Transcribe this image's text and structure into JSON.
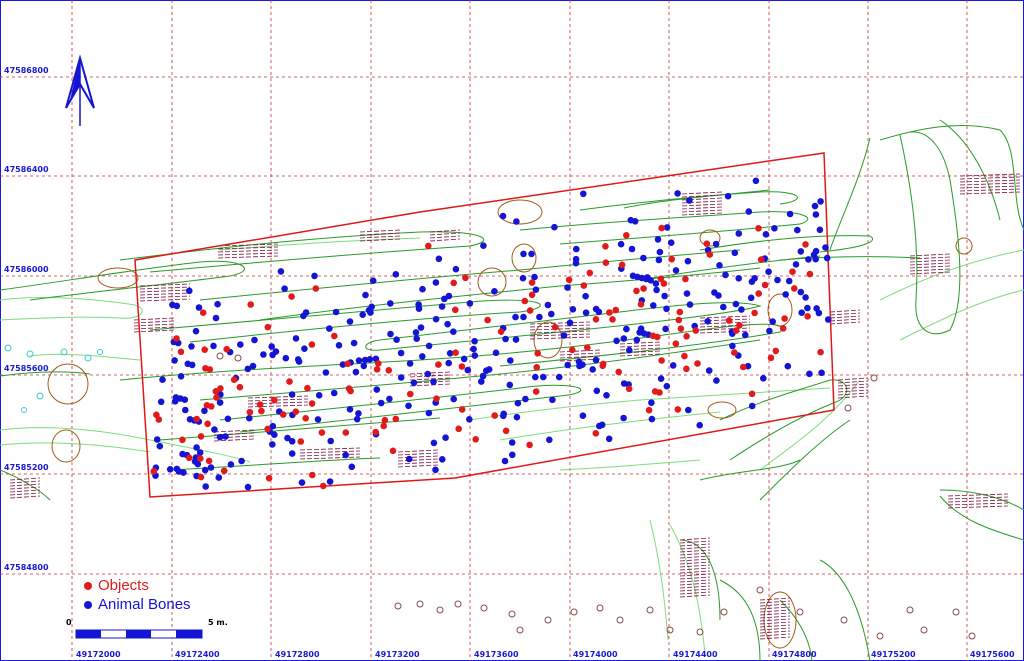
{
  "map": {
    "legend": {
      "objects": {
        "label": "Objects",
        "color": "#e11b1b"
      },
      "animal_bones": {
        "label": "Animal Bones",
        "color": "#1414d4"
      }
    },
    "scale": {
      "start_label": "0",
      "end_label": "5 m."
    },
    "x_ticks": [
      "49172000",
      "49172400",
      "49172800",
      "49173200",
      "49173600",
      "49174000",
      "49174400",
      "49174800",
      "49175200",
      "49175600"
    ],
    "y_ticks": [
      "47586800",
      "47586400",
      "47586000",
      "47585600",
      "47585200",
      "47584800"
    ],
    "north_arrow_icon": "north-arrow-icon",
    "colors": {
      "grid": "#c8323a",
      "excavation_boundary": "#e01818",
      "feature_dark_green": "#2a9a2a",
      "feature_light_green": "#7fdc7f",
      "pit_brown": "#a35a1a",
      "hatching": "#7a1040",
      "coordinate_text": "#1a1ad0"
    }
  }
}
